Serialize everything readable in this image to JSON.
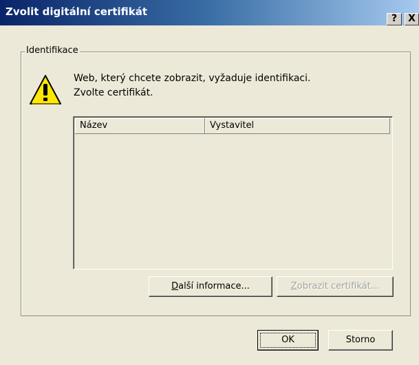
{
  "window": {
    "title": "Zvolit digitální certifikát",
    "help_label": "?",
    "close_label": "X"
  },
  "group": {
    "legend": "Identifikace"
  },
  "message": {
    "line1": "Web, který chcete zobrazit, vyžaduje identifikaci.",
    "line2": "Zvolte certifikát."
  },
  "list": {
    "columns": [
      "Název",
      "Vystavitel"
    ],
    "rows": []
  },
  "buttons": {
    "more_info_accel": "D",
    "more_info_rest": "alší informace...",
    "view_cert_accel": "Z",
    "view_cert_rest": "obrazit certifikát...",
    "ok": "OK",
    "cancel": "Storno"
  },
  "icons": {
    "warning": "warning-icon"
  },
  "colors": {
    "dialog_bg": "#ece9d8",
    "title_start": "#0a246a",
    "title_end": "#a6caf0",
    "warning_fill": "#ffe800"
  }
}
